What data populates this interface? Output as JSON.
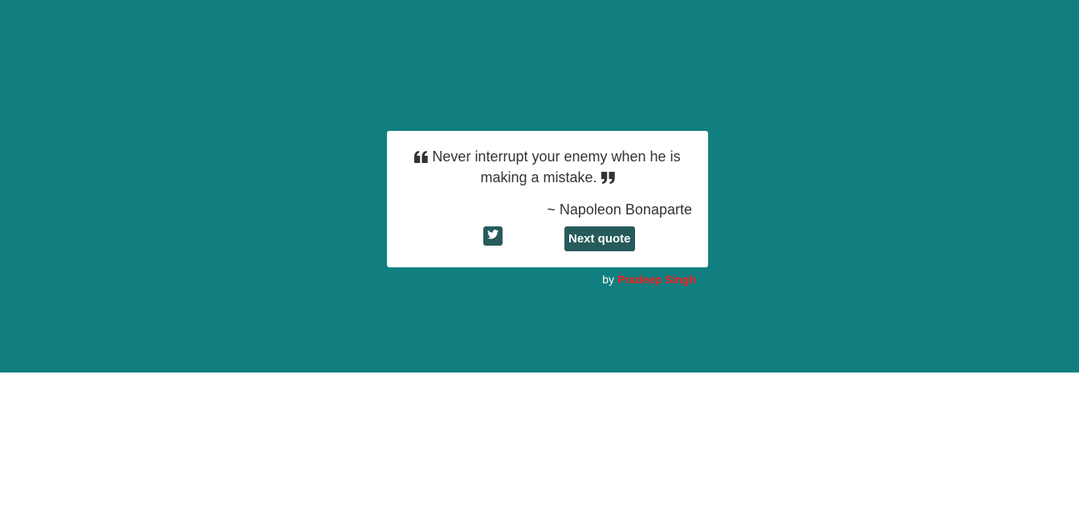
{
  "quote": {
    "text": "Never interrupt your enemy when he is making a mistake.",
    "author": "~ Napoleon Bonaparte",
    "open_icon": "quote-left-icon",
    "close_icon": "quote-right-icon"
  },
  "actions": {
    "tweet_icon": "twitter-icon",
    "next_label": "Next quote"
  },
  "credit": {
    "prefix": "by",
    "name": "Pradeep Singh"
  },
  "colors": {
    "background": "#117f80",
    "card": "#ffffff",
    "button": "#275b5b",
    "credit_name": "#ff1a1a"
  }
}
